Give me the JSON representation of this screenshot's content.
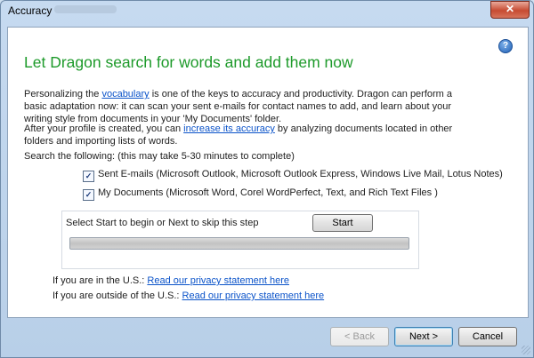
{
  "window": {
    "title": "Accuracy",
    "close_glyph": "✕"
  },
  "help": {
    "icon": "help-icon",
    "glyph": "?"
  },
  "main": {
    "heading": "Let Dragon search for words and add them now",
    "para1": {
      "before": "Personalizing the ",
      "link": "vocabulary",
      "after": " is one of the keys to accuracy and productivity. Dragon can perform a basic adaptation now: it can scan your sent e-mails for contact names to add, and learn about your writing style from documents in your 'My Documents' folder."
    },
    "para2": {
      "before": "After your profile is created, you can ",
      "link": "increase its accuracy",
      "after": " by analyzing documents located in other folders and importing lists of words."
    },
    "search_label": "Search the following: (this may take 5-30 minutes to complete)",
    "options": [
      {
        "label": "Sent E-mails (Microsoft Outlook, Microsoft Outlook Express, Windows Live Mail, Lotus Notes)",
        "checked": true
      },
      {
        "label": "My Documents (Microsoft Word, Corel WordPerfect, Text, and Rich Text Files )",
        "checked": true
      }
    ],
    "panel": {
      "message": "Select Start to begin or Next to skip this step",
      "start_label": "Start",
      "progress": 0
    },
    "privacy": [
      {
        "prefix": "If you are in the U.S.: ",
        "link": "Read our privacy statement here"
      },
      {
        "prefix": "If you are outside of the U.S.: ",
        "link": "Read our privacy statement here"
      }
    ]
  },
  "footer": {
    "back_label": "< Back",
    "next_label": "Next >",
    "cancel_label": "Cancel"
  }
}
